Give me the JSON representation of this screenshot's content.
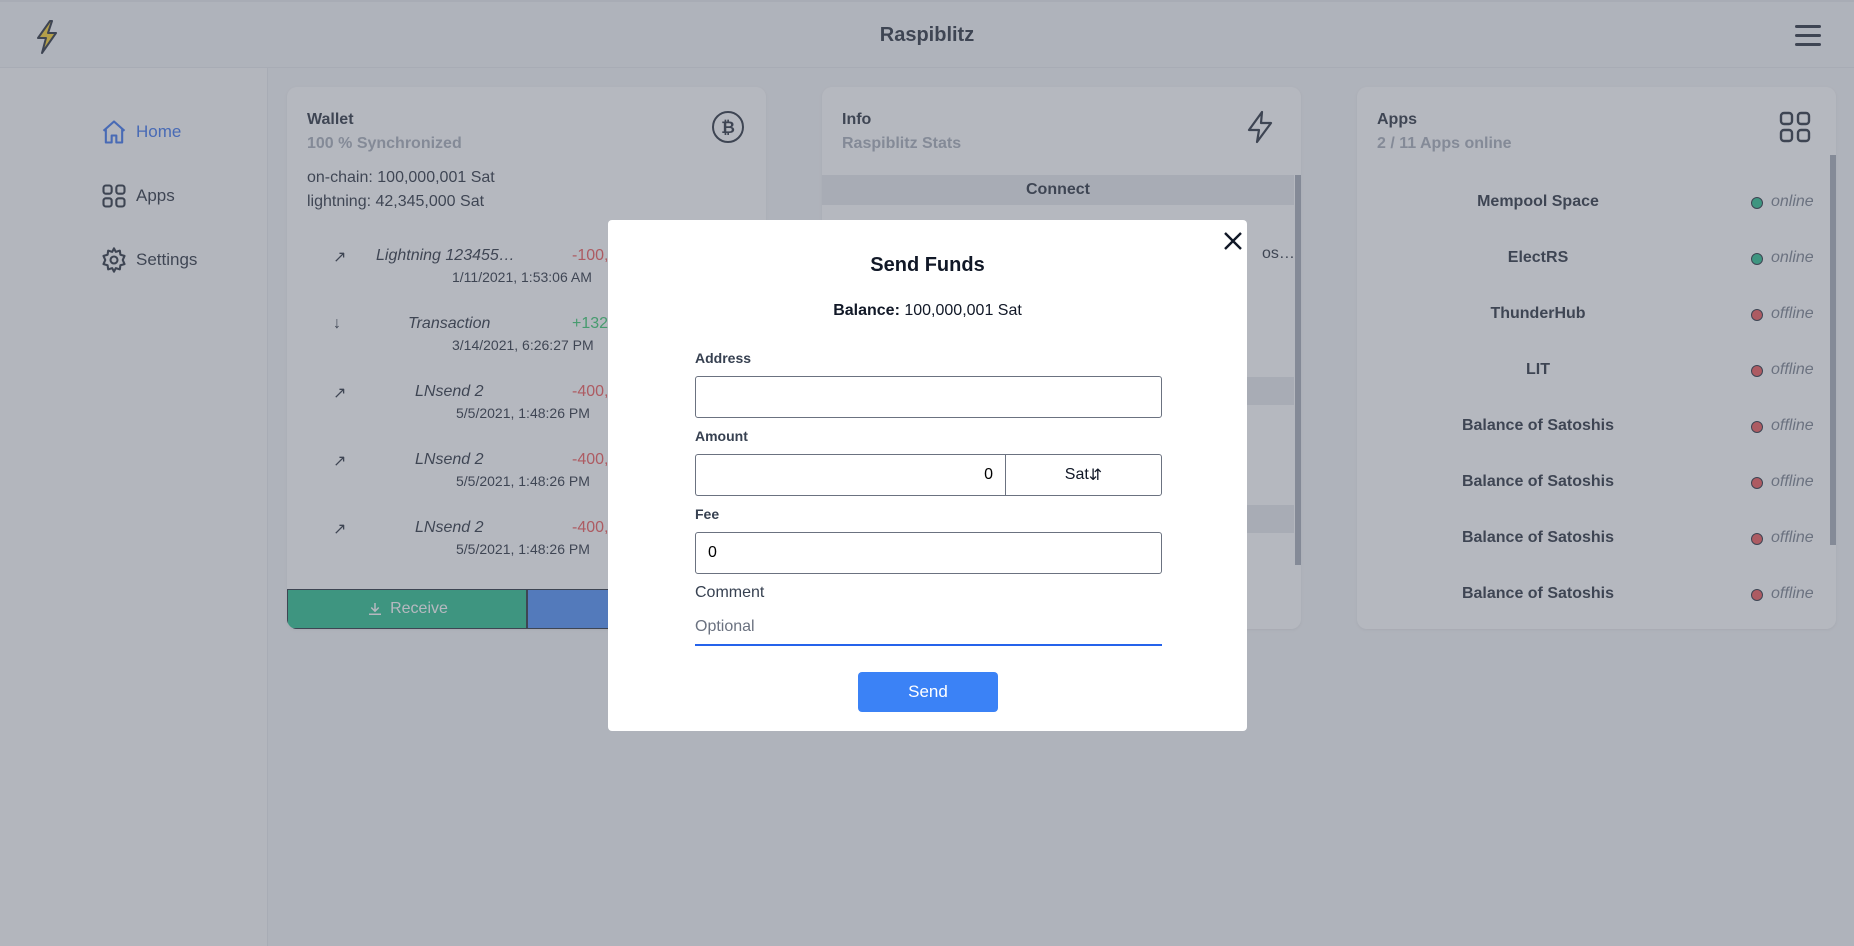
{
  "header": {
    "title": "Raspiblitz"
  },
  "sidebar": {
    "items": [
      {
        "label": "Home",
        "icon": "home-icon",
        "active": true
      },
      {
        "label": "Apps",
        "icon": "grid-icon"
      },
      {
        "label": "Settings",
        "icon": "gear-icon"
      }
    ]
  },
  "wallet": {
    "title": "Wallet",
    "subtitle": "100 % Synchronized",
    "onchain": "on-chain: 100,000,001 Sat",
    "lightning": "lightning: 42,345,000 Sat",
    "transactions": [
      {
        "direction": "up",
        "label": "Lightning 123455…",
        "amount": "-100,",
        "date": "1/11/2021, 1:53:06 AM"
      },
      {
        "direction": "down",
        "label": "Transaction",
        "amount": "+132",
        "date": "3/14/2021, 6:26:27 PM"
      },
      {
        "direction": "up",
        "label": "LNsend 2",
        "amount": "-400,",
        "date": "5/5/2021, 1:48:26 PM"
      },
      {
        "direction": "up",
        "label": "LNsend 2",
        "amount": "-400,",
        "date": "5/5/2021, 1:48:26 PM"
      },
      {
        "direction": "up",
        "label": "LNsend 2",
        "amount": "-400,",
        "date": "5/5/2021, 1:48:26 PM"
      }
    ],
    "receive_label": "Receive"
  },
  "info": {
    "title": "Info",
    "subtitle": "Raspiblitz Stats",
    "connect_label": "Connect",
    "connect_row": "os…"
  },
  "apps": {
    "title": "Apps",
    "subtitle": "2 / 11 Apps online",
    "list": [
      {
        "name": "Mempool Space",
        "status": "online",
        "color": "#10b981"
      },
      {
        "name": "ElectRS",
        "status": "online",
        "color": "#10b981"
      },
      {
        "name": "ThunderHub",
        "status": "offline",
        "color": "#ef4444"
      },
      {
        "name": "LIT",
        "status": "offline",
        "color": "#ef4444"
      },
      {
        "name": "Balance of Satoshis",
        "status": "offline",
        "color": "#ef4444"
      },
      {
        "name": "Balance of Satoshis",
        "status": "offline",
        "color": "#ef4444"
      },
      {
        "name": "Balance of Satoshis",
        "status": "offline",
        "color": "#ef4444"
      },
      {
        "name": "Balance of Satoshis",
        "status": "offline",
        "color": "#ef4444"
      }
    ]
  },
  "modal": {
    "title": "Send Funds",
    "balance_label": "Balance:",
    "balance_value": "100,000,001 Sat",
    "address_label": "Address",
    "address_value": "",
    "amount_label": "Amount",
    "amount_value": "0",
    "unit_label": "Sat",
    "unit_icon": "swap-vertical-icon",
    "fee_label": "Fee",
    "fee_value": "0",
    "comment_label": "Comment",
    "comment_placeholder": "Optional",
    "send_label": "Send"
  },
  "colors": {
    "primary": "#3b82f6",
    "success": "#10b981",
    "danger": "#ef4444"
  }
}
